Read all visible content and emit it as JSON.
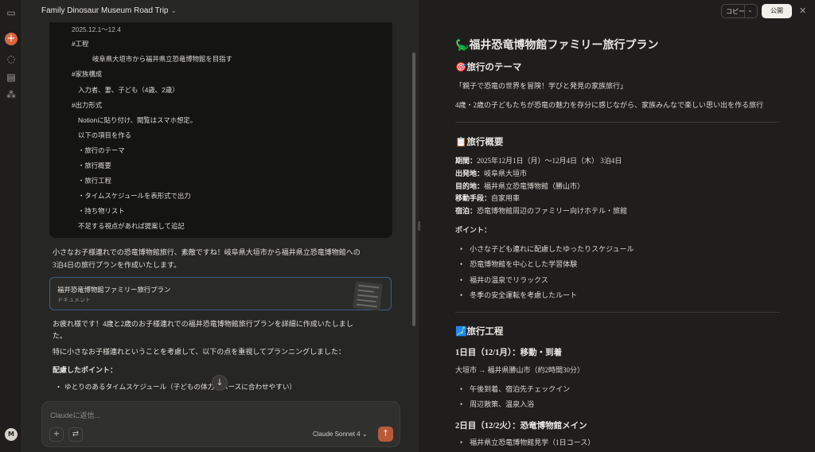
{
  "sidebar": {
    "avatar_initial": "M"
  },
  "chat": {
    "title": "Family Dinosaur Museum Road Trip",
    "prompt_lines": [
      "2025.12.1〜12.4",
      "#工程",
      "岐阜県大垣市から福井県立恐竜博物館を目指す",
      "#家族構成",
      "入力者、妻、子ども（4歳、2歳）",
      "#出力形式",
      "Notionに貼り付け、閲覧はスマホ想定。",
      "以下の項目を作る",
      "・旅行のテーマ",
      "・旅行概要",
      "・旅行工程",
      "・タイムスケジュールを表形式で出力",
      "・持ち物リスト",
      "不足する視点があれば提案して追記"
    ],
    "reply1_line1": "小さなお子様連れでの恐竜博物館旅行、素敵ですね！岐阜県大垣市から福井県立恐竜博物館への",
    "reply1_line2": "3泊4日の旅行プランを作成いたします。",
    "doc_card": {
      "title": "福井恐竜博物館ファミリー旅行プラン",
      "subtitle": "ドキュメント"
    },
    "reply2_line1": "お疲れ様です！4歳と2歳のお子様連れでの福井恐竜博物館旅行プランを詳細に作成いたしまし",
    "reply2_line2": "た。",
    "reply3": "特に小さなお子様連れということを考慮して、以下の点を重視してプランニングしました：",
    "points_heading": "配慮したポイント：",
    "point1": "ゆとりのあるタイムスケジュール（子どもの体力やペースに合わせやすい）",
    "composer_placeholder": "Claudeに返信...",
    "model_name": "Claude Sonnet 4"
  },
  "panel": {
    "copy_label": "コピー",
    "publish_label": "公開",
    "title": "🦕福井恐竜博物館ファミリー旅行プラン",
    "theme_heading": "🎯旅行のテーマ",
    "theme_quote": "「親子で恐竜の世界を冒険！学びと発見の家族旅行」",
    "theme_desc": "4歳・2歳の子どもたちが恐竜の魅力を存分に感じながら、家族みんなで楽しい思い出を作る旅行",
    "overview_heading": "📋旅行概要",
    "overview": [
      {
        "label": "期間：",
        "value": "2025年12月1日（月）〜12月4日（木） 3泊4日"
      },
      {
        "label": "出発地：",
        "value": "岐阜県大垣市"
      },
      {
        "label": "目的地：",
        "value": "福井県立恐竜博物館（勝山市）"
      },
      {
        "label": "移動手段：",
        "value": "自家用車"
      },
      {
        "label": "宿泊：",
        "value": "恐竜博物館周辺のファミリー向けホテル・旅館"
      }
    ],
    "points_label": "ポイント：",
    "points": [
      "小さな子ども連れに配慮したゆったりスケジュール",
      "恐竜博物館を中心とした学習体験",
      "福井の温泉でリラックス",
      "冬季の安全運転を考慮したルート"
    ],
    "itinerary_heading": "🗾旅行工程",
    "day1_heading": "1日目（12/1月）：移動・到着",
    "day1_route": "大垣市 → 福井県勝山市（約2時間30分）",
    "day1_items": [
      "午後到着、宿泊先チェックイン",
      "周辺散策、温泉入浴"
    ],
    "day2_heading": "2日目（12/2火）：恐竜博物館メイン",
    "day2_items": [
      "福井県立恐竜博物館見学（1日コース）"
    ]
  }
}
